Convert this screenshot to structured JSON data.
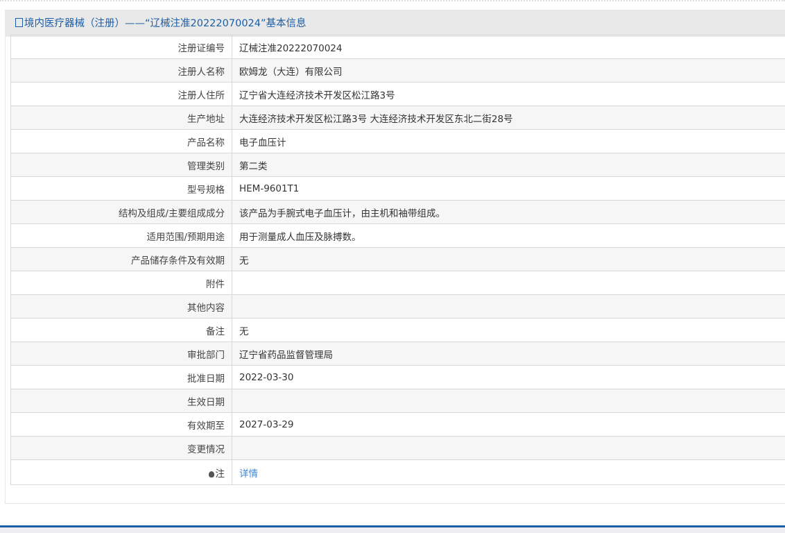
{
  "header": {
    "title": "境内医疗器械（注册）——“辽械注准20222070024”基本信息"
  },
  "rows": [
    {
      "label": "注册证编号",
      "value": "辽械注准20222070024"
    },
    {
      "label": "注册人名称",
      "value": "欧姆龙（大连）有限公司"
    },
    {
      "label": "注册人住所",
      "value": "辽宁省大连经济技术开发区松江路3号"
    },
    {
      "label": "生产地址",
      "value": "大连经济技术开发区松江路3号 大连经济技术开发区东北二街28号"
    },
    {
      "label": "产品名称",
      "value": "电子血压计"
    },
    {
      "label": "管理类别",
      "value": "第二类"
    },
    {
      "label": "型号规格",
      "value": "HEM-9601T1"
    },
    {
      "label": "结构及组成/主要组成成分",
      "value": "该产品为手腕式电子血压计，由主机和袖带组成。"
    },
    {
      "label": "适用范围/预期用途",
      "value": "用于测量成人血压及脉搏数。"
    },
    {
      "label": "产品储存条件及有效期",
      "value": "无"
    },
    {
      "label": "附件",
      "value": ""
    },
    {
      "label": "其他内容",
      "value": ""
    },
    {
      "label": "备注",
      "value": "无"
    },
    {
      "label": "审批部门",
      "value": "辽宁省药品监督管理局"
    },
    {
      "label": "批准日期",
      "value": "2022-03-30"
    },
    {
      "label": "生效日期",
      "value": ""
    },
    {
      "label": "有效期至",
      "value": "2027-03-29"
    },
    {
      "label": "变更情况",
      "value": ""
    }
  ],
  "note": {
    "label": "注",
    "link": "详情"
  }
}
